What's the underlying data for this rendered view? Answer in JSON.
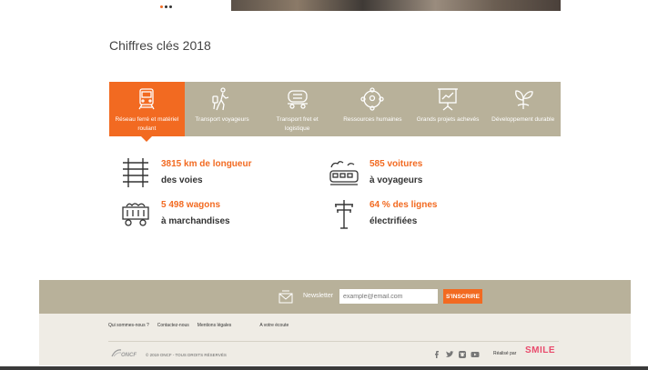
{
  "carousel": {
    "dots": 3,
    "active_dot": 1
  },
  "section": {
    "title": "Chiffres clés 2018"
  },
  "tabs": [
    {
      "label": "Réseau ferré et matériel roulant",
      "icon": "train-icon",
      "active": true
    },
    {
      "label": "Transport voyageurs",
      "icon": "traveler-icon",
      "active": false
    },
    {
      "label": "Transport fret et logistique",
      "icon": "freight-wagon-icon",
      "active": false
    },
    {
      "label": "Ressources humaines",
      "icon": "people-network-icon",
      "active": false
    },
    {
      "label": "Grands projets achevés",
      "icon": "presentation-board-icon",
      "active": false
    },
    {
      "label": "Développement durable",
      "icon": "leaves-icon",
      "active": false
    }
  ],
  "stats": [
    {
      "value": "3815 km de longueur",
      "desc": "des voies",
      "icon": "railway-track-icon"
    },
    {
      "value": "585 voitures",
      "desc": "à voyageurs",
      "icon": "passenger-train-icon"
    },
    {
      "value": "5 498 wagons",
      "desc": "à marchandises",
      "icon": "coal-wagon-icon"
    },
    {
      "value": "64 % des lignes",
      "desc": "électrifiées",
      "icon": "electric-pylon-icon"
    }
  ],
  "newsletter": {
    "label": "Newsletter",
    "placeholder": "example@email.com",
    "button": "S'INSCRIRE"
  },
  "footer": {
    "links": [
      "Qui sommes-nous ?",
      "Contactez-nous",
      "Mentions légales",
      "A votre écoute"
    ],
    "logo_text": "ONCF",
    "copyright": "© 2019 ONCF - TOUS DROITS RÉSERVÉS",
    "social": [
      "facebook-icon",
      "twitter-icon",
      "instagram-icon",
      "youtube-icon"
    ],
    "realise_par": "Réalisé par",
    "agency": "SMILE"
  },
  "colors": {
    "accent": "#f26a21",
    "tab_bg": "#b8b19a",
    "footer_bottom_bg": "#efece5"
  }
}
